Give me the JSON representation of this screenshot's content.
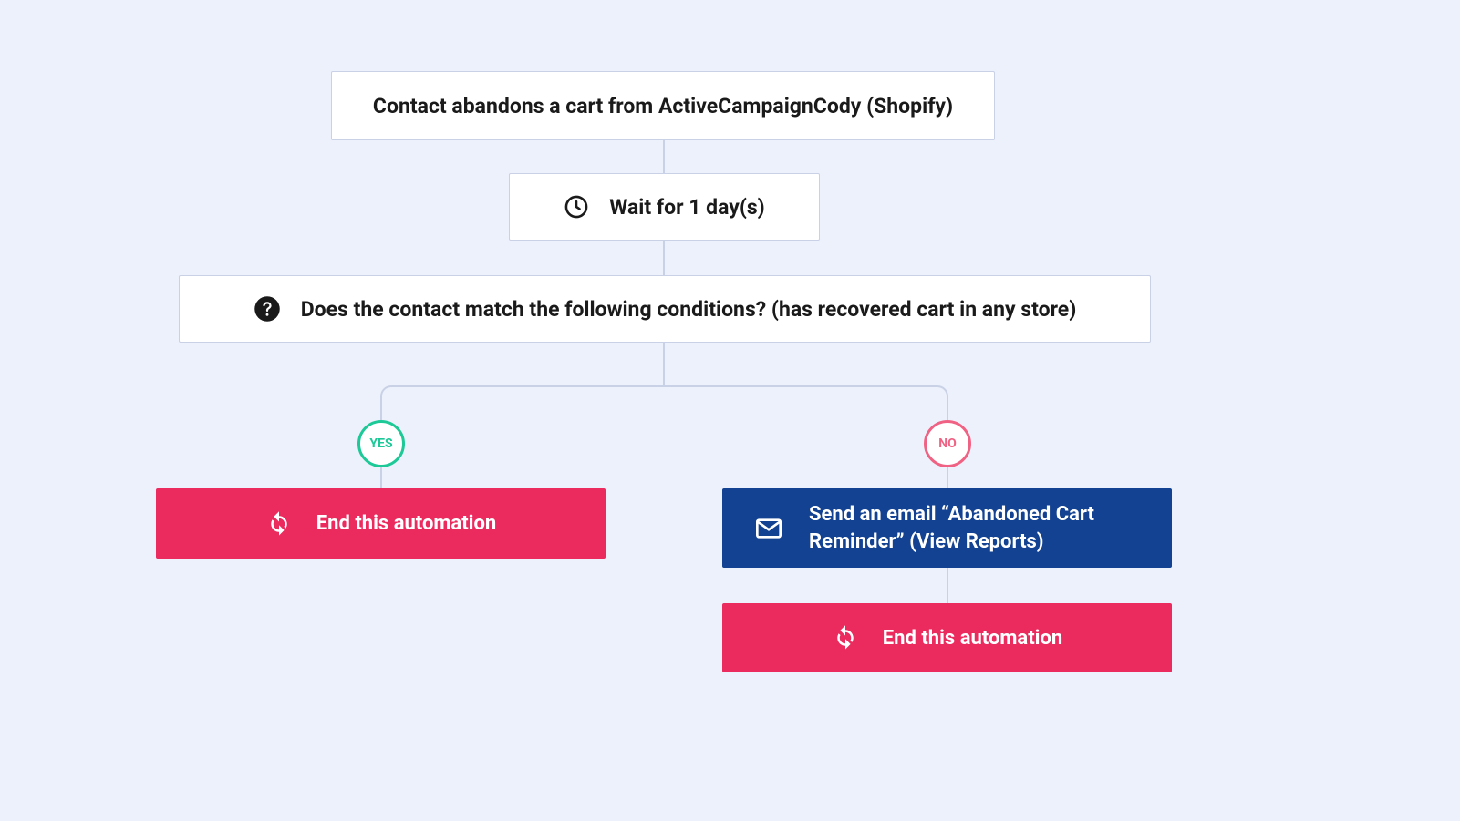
{
  "trigger": {
    "label": "Contact abandons a cart from ActiveCampaignCody (Shopify)"
  },
  "wait": {
    "label": "Wait for 1 day(s)"
  },
  "condition": {
    "label": "Does the contact match the following conditions? (has recovered cart in any store)"
  },
  "branches": {
    "yes_label": "YES",
    "no_label": "NO"
  },
  "yes_path": {
    "end_label": "End this automation"
  },
  "no_path": {
    "email_label": "Send an email “Abandoned Cart Reminder” (View Reports)",
    "end_label": "End this automation"
  }
}
